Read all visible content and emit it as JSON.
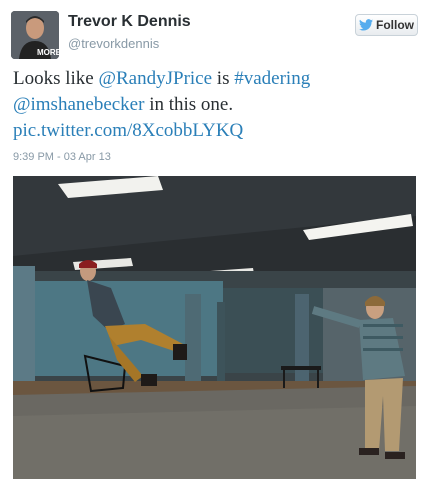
{
  "user": {
    "name": "Trevor K Dennis",
    "handle": "@trevorkdennis",
    "avatar_text": "MORE"
  },
  "follow_button": {
    "label": "Follow"
  },
  "tweet": {
    "text_1": "Looks like ",
    "mention_1": "@RandyJPrice",
    "text_2": " is ",
    "hashtag": "#vadering",
    "mention_2": "@imshanebecker",
    "text_3": " in this one.",
    "link": "pic.twitter.com/8XcobbLYKQ"
  },
  "timestamp": "9:39 PM - 03 Apr 13",
  "colors": {
    "link": "#2a7fb8",
    "bird": "#55acee",
    "name": "#292f33",
    "meta": "#8899a6"
  }
}
